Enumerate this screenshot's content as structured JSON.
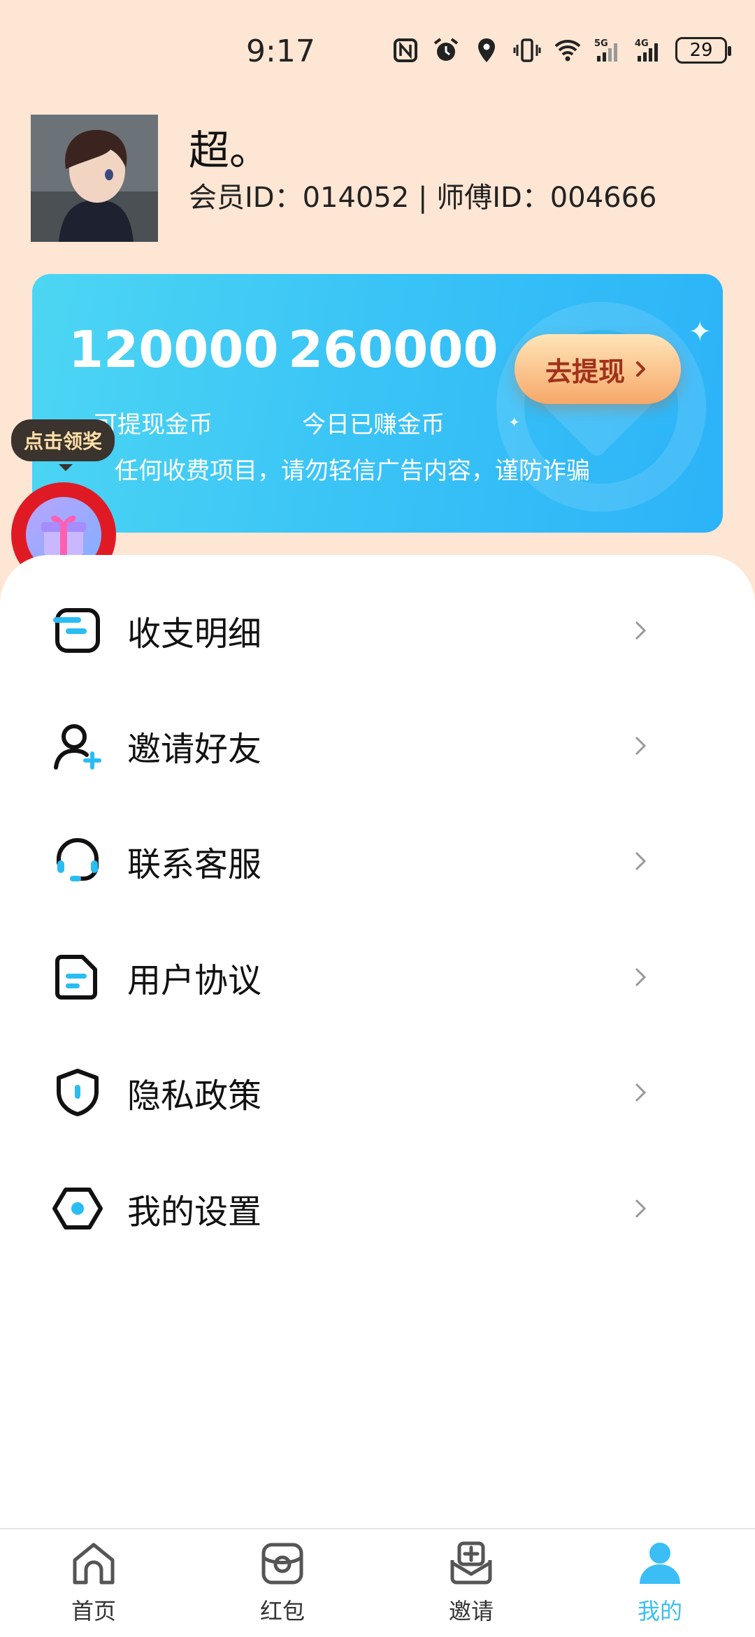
{
  "status_bar": {
    "time": "9:17",
    "battery": "29",
    "signal_5g": "5G",
    "signal_4g": "4G"
  },
  "profile": {
    "nickname": "超。",
    "member_line": "会员ID：014052 | 师傅ID：004666"
  },
  "coins": {
    "withdrawable_value": "120000",
    "withdrawable_label": "可提现金币",
    "today_value": "260000",
    "today_label": "今日已赚金币",
    "withdraw_button": "去提现",
    "notice": "任何收费项目，请勿轻信广告内容，谨防诈骗"
  },
  "reward": {
    "tip": "点击领奖"
  },
  "menu": [
    {
      "label": "收支明细",
      "icon": "ledger-icon"
    },
    {
      "label": "邀请好友",
      "icon": "add-friend-icon"
    },
    {
      "label": "联系客服",
      "icon": "headset-icon"
    },
    {
      "label": "用户协议",
      "icon": "document-icon"
    },
    {
      "label": "隐私政策",
      "icon": "shield-icon"
    },
    {
      "label": "我的设置",
      "icon": "settings-icon"
    }
  ],
  "nav": [
    {
      "label": "首页",
      "icon": "home-icon"
    },
    {
      "label": "红包",
      "icon": "red-packet-icon"
    },
    {
      "label": "邀请",
      "icon": "invite-icon"
    },
    {
      "label": "我的",
      "icon": "profile-icon",
      "active": true
    }
  ],
  "colors": {
    "accent": "#3bbef6",
    "background": "#fde6d3",
    "withdraw_text": "#a0311a"
  }
}
